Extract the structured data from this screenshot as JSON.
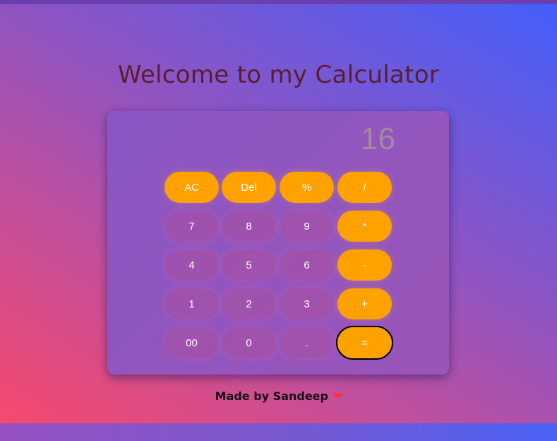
{
  "page": {
    "title": "Welcome to my Calculator",
    "footer": "Made by Sandeep",
    "footer_icon": "heart-icon",
    "footer_icon_glyph": "❤"
  },
  "calculator": {
    "display_value": "16",
    "keys": [
      {
        "label": "AC",
        "type": "operator"
      },
      {
        "label": "Del",
        "type": "operator"
      },
      {
        "label": "%",
        "type": "operator"
      },
      {
        "label": "/",
        "type": "operator"
      },
      {
        "label": "7",
        "type": "digit"
      },
      {
        "label": "8",
        "type": "digit"
      },
      {
        "label": "9",
        "type": "digit"
      },
      {
        "label": "*",
        "type": "operator"
      },
      {
        "label": "4",
        "type": "digit"
      },
      {
        "label": "5",
        "type": "digit"
      },
      {
        "label": "6",
        "type": "digit"
      },
      {
        "label": "-",
        "type": "operator"
      },
      {
        "label": "1",
        "type": "digit"
      },
      {
        "label": "2",
        "type": "digit"
      },
      {
        "label": "3",
        "type": "digit"
      },
      {
        "label": "+",
        "type": "operator"
      },
      {
        "label": "00",
        "type": "digit"
      },
      {
        "label": "0",
        "type": "digit"
      },
      {
        "label": ".",
        "type": "digit"
      },
      {
        "label": "=",
        "type": "operator",
        "focused": true
      }
    ]
  },
  "colors": {
    "operator_key": "#ffa200",
    "title_text": "#5a1e2e",
    "display_text": "#a58a9c",
    "heart": "#ff3344"
  }
}
